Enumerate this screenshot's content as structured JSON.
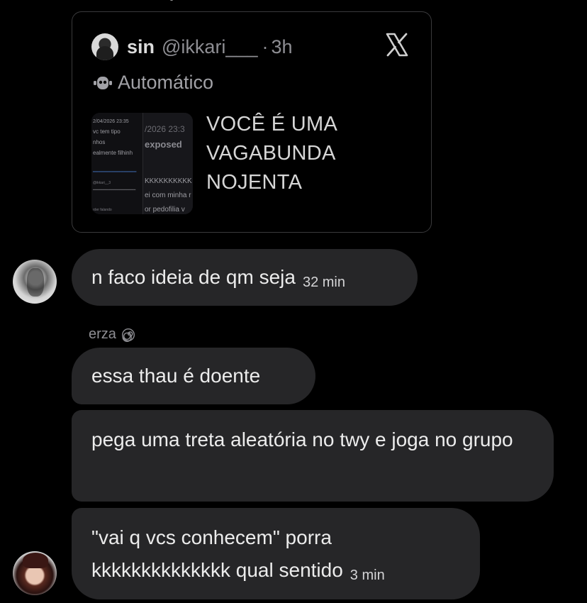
{
  "tweet": {
    "name": "sin",
    "handle": "@ikkari___",
    "separator": "·",
    "time": "3h",
    "label": "Automático",
    "text": "VOCÊ É UMA VAGABUNDA NOJENTA",
    "media_preview": {
      "col_a_lines": [
        "2/04/2026 23:35",
        "vc tem tipo",
        "nhos",
        "ealmente filhinh",
        "@ikkari__3",
        "rder falando"
      ],
      "col_b_lines": [
        "/2026 23:3",
        "exposed",
        "KKKKKKKKKK",
        "ei com minha r",
        "or pedofilia v"
      ]
    }
  },
  "messages": [
    {
      "text": "n faco ideia de qm seja",
      "time": "32 min"
    },
    {
      "sender": "erza",
      "text": "essa thau é doente"
    },
    {
      "text": "pega uma treta aleatória no twy e joga no grupo"
    },
    {
      "text": "\"vai q vcs conhecem\" porra kkkkkkkkkkkkkk qual sentido",
      "time": "3 min"
    }
  ],
  "icons": {
    "tweet_logo": "x-logo-icon",
    "automated": "bot-icon",
    "sender_badge": "spiral-icon"
  },
  "colors": {
    "background": "#000000",
    "bubble": "#262628",
    "secondary_text": "#8e8e93"
  }
}
